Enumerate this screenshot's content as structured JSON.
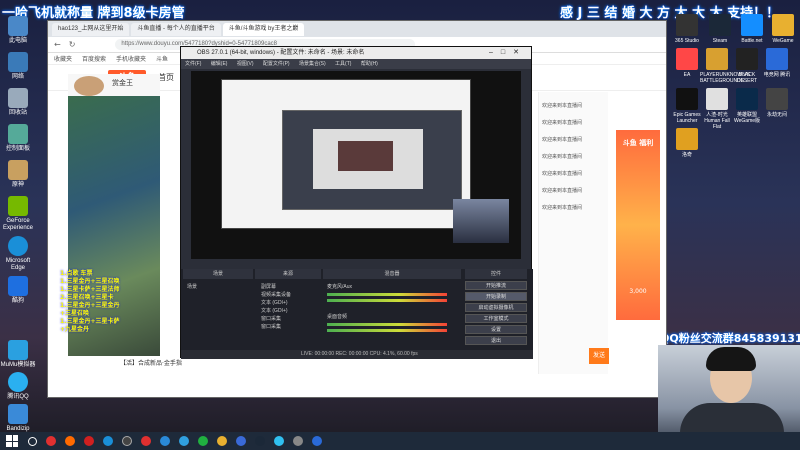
{
  "overlay": {
    "top_left": "一哈飞机就称量 牌到8级卡房管",
    "top_right": "感 J 三 结 婚 大 方 大 大 大 支持！！",
    "qq_group": "QQ粉丝交流群845839131",
    "left_lines": [
      "1.点歌 车票",
      "1.三星金丹+三星召唤",
      "1.三星卡萨+三星法师",
      "2.三星召唤+三星卡",
      "1.三星金丹+三星金丹+三星召唤",
      "1.三星金丹+三星卡萨+九星金丹"
    ]
  },
  "desktop_icons": [
    "此电脑",
    "网络",
    "回收站",
    "控制面板",
    "原神",
    "GeForce Experience",
    "Microsoft Edge",
    "酷狗",
    "MuMu模拟器",
    "腾讯QQ",
    "Bandizip"
  ],
  "right_icons": [
    "365 Studio",
    "Steam",
    "Battle.net",
    "WeGame",
    "EA",
    "PLAYERUNKNOWN'S BATTLEGROUNDS",
    "BLACK DESERT",
    "电竞网 腾讯",
    "Epic Games Launcher",
    "人渣-时光 Human Fall Flat",
    "英雄联盟 WeGame版",
    "永劫无间",
    "洛奇"
  ],
  "browser": {
    "tabs": [
      "hao123_上网从这里开始",
      "斗鱼直播 - 每个人的直播平台",
      "斗鱼/斗鱼游戏 by王者之巅"
    ],
    "url": "https://www.douyu.com/5477180?dyshid=0-54771809cac8",
    "bookmarks": [
      "收藏夹",
      "百度搜索",
      "手机收藏夹",
      "斗鱼"
    ],
    "logo": "斗鱼",
    "nav_home": "首页",
    "streamer_name": "赏金王",
    "danmu": [
      "欢迎来到本直播间",
      "欢迎来到本直播间",
      "欢迎来到本直播间",
      "欢迎来到本直播间",
      "欢迎来到本直播间",
      "欢迎来到本直播间",
      "欢迎来到本直播间"
    ],
    "send_label": "发送",
    "promo_bottom": "【活】合成新品·金手指",
    "ad_title": "斗鱼 福利",
    "ad_sub": "3,000"
  },
  "obs": {
    "title": "OBS 27.0.1 (64-bit, windows) - 配置文件: 未命名 - 场景: 未命名",
    "menu": [
      "文件(F)",
      "编辑(E)",
      "视图(V)",
      "配置文件(P)",
      "场景集合(S)",
      "工具(T)",
      "帮助(H)"
    ],
    "panels": [
      "场景",
      "来源",
      "混音器",
      "转场特效",
      "控件"
    ],
    "scene": "场景",
    "sources": [
      "副屏幕",
      "视频采集设备",
      "文本 (GDI+)",
      "文本 (GDI+)",
      "窗口采集",
      "窗口采集"
    ],
    "mixer": [
      "麦克风/Aux",
      "桌面音频"
    ],
    "controls": [
      "开始推流",
      "开始录制",
      "启动虚拟摄像机",
      "工作室模式",
      "设置",
      "退出"
    ],
    "status": "LIVE: 00:00:00   REC: 00:00:00   CPU: 4.1%, 60.00 fps"
  },
  "colors": {
    "accent": "#ff5a2a",
    "send": "#ff7a1a",
    "taskbar": "#1e2a3a"
  }
}
